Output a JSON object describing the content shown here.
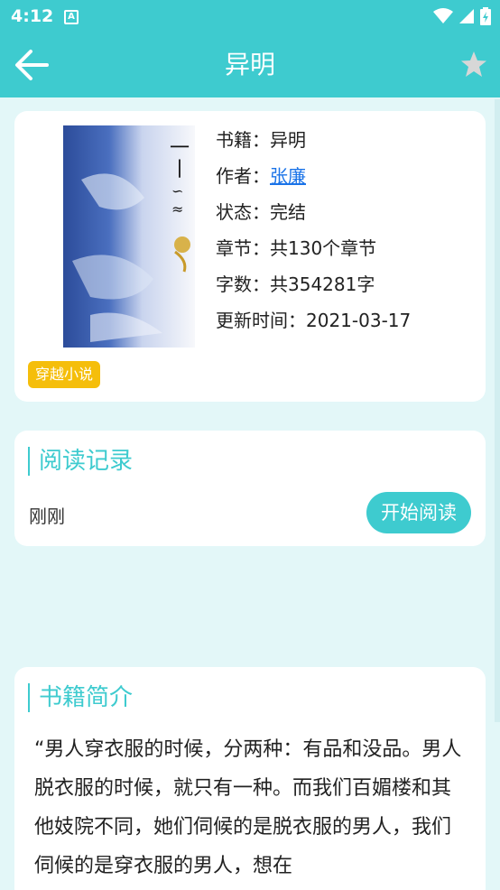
{
  "status_bar": {
    "time": "4:12",
    "notification_letter": "A"
  },
  "app_bar": {
    "title": "异明"
  },
  "book": {
    "title_line": "书籍：异明",
    "author_label": "作者：",
    "author_name": "张廉",
    "status_line": "状态：完结",
    "chapters_line": "章节：共130个章节",
    "words_line": "字数：共354281字",
    "updated_line": "更新时间：2021-03-17",
    "tag": "穿越小说"
  },
  "reading_record": {
    "title": "阅读记录",
    "last_read": "刚刚",
    "start_button": "开始阅读"
  },
  "intro_section": {
    "title": "书籍简介",
    "text": "“男人穿衣服的时候，分两种：有品和没品。男人脱衣服的时候，就只有一种。而我们百媚楼和其他妓院不同，她们伺候的是脱衣服的男人，我们伺候的是穿衣服的男人，想在"
  },
  "colors": {
    "accent": "#3ECBCF",
    "tag": "#F5BE0B",
    "link": "#1a73e8",
    "background": "#E3F7F8"
  }
}
